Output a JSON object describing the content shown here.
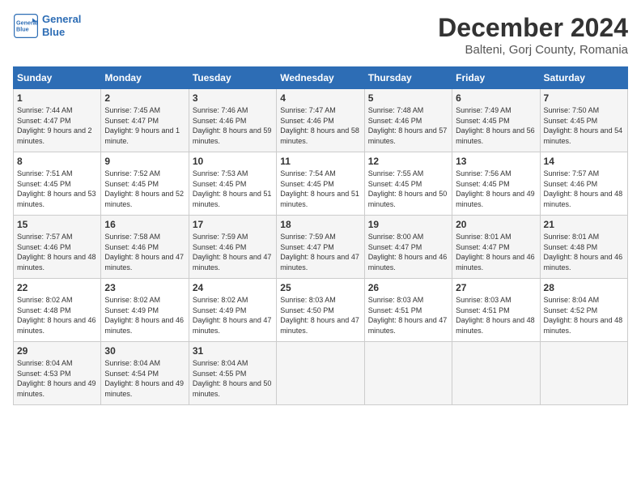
{
  "header": {
    "logo_line1": "General",
    "logo_line2": "Blue",
    "month": "December 2024",
    "location": "Balteni, Gorj County, Romania"
  },
  "weekdays": [
    "Sunday",
    "Monday",
    "Tuesday",
    "Wednesday",
    "Thursday",
    "Friday",
    "Saturday"
  ],
  "weeks": [
    [
      {
        "day": "1",
        "sunrise": "Sunrise: 7:44 AM",
        "sunset": "Sunset: 4:47 PM",
        "daylight": "Daylight: 9 hours and 2 minutes."
      },
      {
        "day": "2",
        "sunrise": "Sunrise: 7:45 AM",
        "sunset": "Sunset: 4:47 PM",
        "daylight": "Daylight: 9 hours and 1 minute."
      },
      {
        "day": "3",
        "sunrise": "Sunrise: 7:46 AM",
        "sunset": "Sunset: 4:46 PM",
        "daylight": "Daylight: 8 hours and 59 minutes."
      },
      {
        "day": "4",
        "sunrise": "Sunrise: 7:47 AM",
        "sunset": "Sunset: 4:46 PM",
        "daylight": "Daylight: 8 hours and 58 minutes."
      },
      {
        "day": "5",
        "sunrise": "Sunrise: 7:48 AM",
        "sunset": "Sunset: 4:46 PM",
        "daylight": "Daylight: 8 hours and 57 minutes."
      },
      {
        "day": "6",
        "sunrise": "Sunrise: 7:49 AM",
        "sunset": "Sunset: 4:45 PM",
        "daylight": "Daylight: 8 hours and 56 minutes."
      },
      {
        "day": "7",
        "sunrise": "Sunrise: 7:50 AM",
        "sunset": "Sunset: 4:45 PM",
        "daylight": "Daylight: 8 hours and 54 minutes."
      }
    ],
    [
      {
        "day": "8",
        "sunrise": "Sunrise: 7:51 AM",
        "sunset": "Sunset: 4:45 PM",
        "daylight": "Daylight: 8 hours and 53 minutes."
      },
      {
        "day": "9",
        "sunrise": "Sunrise: 7:52 AM",
        "sunset": "Sunset: 4:45 PM",
        "daylight": "Daylight: 8 hours and 52 minutes."
      },
      {
        "day": "10",
        "sunrise": "Sunrise: 7:53 AM",
        "sunset": "Sunset: 4:45 PM",
        "daylight": "Daylight: 8 hours and 51 minutes."
      },
      {
        "day": "11",
        "sunrise": "Sunrise: 7:54 AM",
        "sunset": "Sunset: 4:45 PM",
        "daylight": "Daylight: 8 hours and 51 minutes."
      },
      {
        "day": "12",
        "sunrise": "Sunrise: 7:55 AM",
        "sunset": "Sunset: 4:45 PM",
        "daylight": "Daylight: 8 hours and 50 minutes."
      },
      {
        "day": "13",
        "sunrise": "Sunrise: 7:56 AM",
        "sunset": "Sunset: 4:45 PM",
        "daylight": "Daylight: 8 hours and 49 minutes."
      },
      {
        "day": "14",
        "sunrise": "Sunrise: 7:57 AM",
        "sunset": "Sunset: 4:46 PM",
        "daylight": "Daylight: 8 hours and 48 minutes."
      }
    ],
    [
      {
        "day": "15",
        "sunrise": "Sunrise: 7:57 AM",
        "sunset": "Sunset: 4:46 PM",
        "daylight": "Daylight: 8 hours and 48 minutes."
      },
      {
        "day": "16",
        "sunrise": "Sunrise: 7:58 AM",
        "sunset": "Sunset: 4:46 PM",
        "daylight": "Daylight: 8 hours and 47 minutes."
      },
      {
        "day": "17",
        "sunrise": "Sunrise: 7:59 AM",
        "sunset": "Sunset: 4:46 PM",
        "daylight": "Daylight: 8 hours and 47 minutes."
      },
      {
        "day": "18",
        "sunrise": "Sunrise: 7:59 AM",
        "sunset": "Sunset: 4:47 PM",
        "daylight": "Daylight: 8 hours and 47 minutes."
      },
      {
        "day": "19",
        "sunrise": "Sunrise: 8:00 AM",
        "sunset": "Sunset: 4:47 PM",
        "daylight": "Daylight: 8 hours and 46 minutes."
      },
      {
        "day": "20",
        "sunrise": "Sunrise: 8:01 AM",
        "sunset": "Sunset: 4:47 PM",
        "daylight": "Daylight: 8 hours and 46 minutes."
      },
      {
        "day": "21",
        "sunrise": "Sunrise: 8:01 AM",
        "sunset": "Sunset: 4:48 PM",
        "daylight": "Daylight: 8 hours and 46 minutes."
      }
    ],
    [
      {
        "day": "22",
        "sunrise": "Sunrise: 8:02 AM",
        "sunset": "Sunset: 4:48 PM",
        "daylight": "Daylight: 8 hours and 46 minutes."
      },
      {
        "day": "23",
        "sunrise": "Sunrise: 8:02 AM",
        "sunset": "Sunset: 4:49 PM",
        "daylight": "Daylight: 8 hours and 46 minutes."
      },
      {
        "day": "24",
        "sunrise": "Sunrise: 8:02 AM",
        "sunset": "Sunset: 4:49 PM",
        "daylight": "Daylight: 8 hours and 47 minutes."
      },
      {
        "day": "25",
        "sunrise": "Sunrise: 8:03 AM",
        "sunset": "Sunset: 4:50 PM",
        "daylight": "Daylight: 8 hours and 47 minutes."
      },
      {
        "day": "26",
        "sunrise": "Sunrise: 8:03 AM",
        "sunset": "Sunset: 4:51 PM",
        "daylight": "Daylight: 8 hours and 47 minutes."
      },
      {
        "day": "27",
        "sunrise": "Sunrise: 8:03 AM",
        "sunset": "Sunset: 4:51 PM",
        "daylight": "Daylight: 8 hours and 48 minutes."
      },
      {
        "day": "28",
        "sunrise": "Sunrise: 8:04 AM",
        "sunset": "Sunset: 4:52 PM",
        "daylight": "Daylight: 8 hours and 48 minutes."
      }
    ],
    [
      {
        "day": "29",
        "sunrise": "Sunrise: 8:04 AM",
        "sunset": "Sunset: 4:53 PM",
        "daylight": "Daylight: 8 hours and 49 minutes."
      },
      {
        "day": "30",
        "sunrise": "Sunrise: 8:04 AM",
        "sunset": "Sunset: 4:54 PM",
        "daylight": "Daylight: 8 hours and 49 minutes."
      },
      {
        "day": "31",
        "sunrise": "Sunrise: 8:04 AM",
        "sunset": "Sunset: 4:55 PM",
        "daylight": "Daylight: 8 hours and 50 minutes."
      },
      null,
      null,
      null,
      null
    ]
  ]
}
